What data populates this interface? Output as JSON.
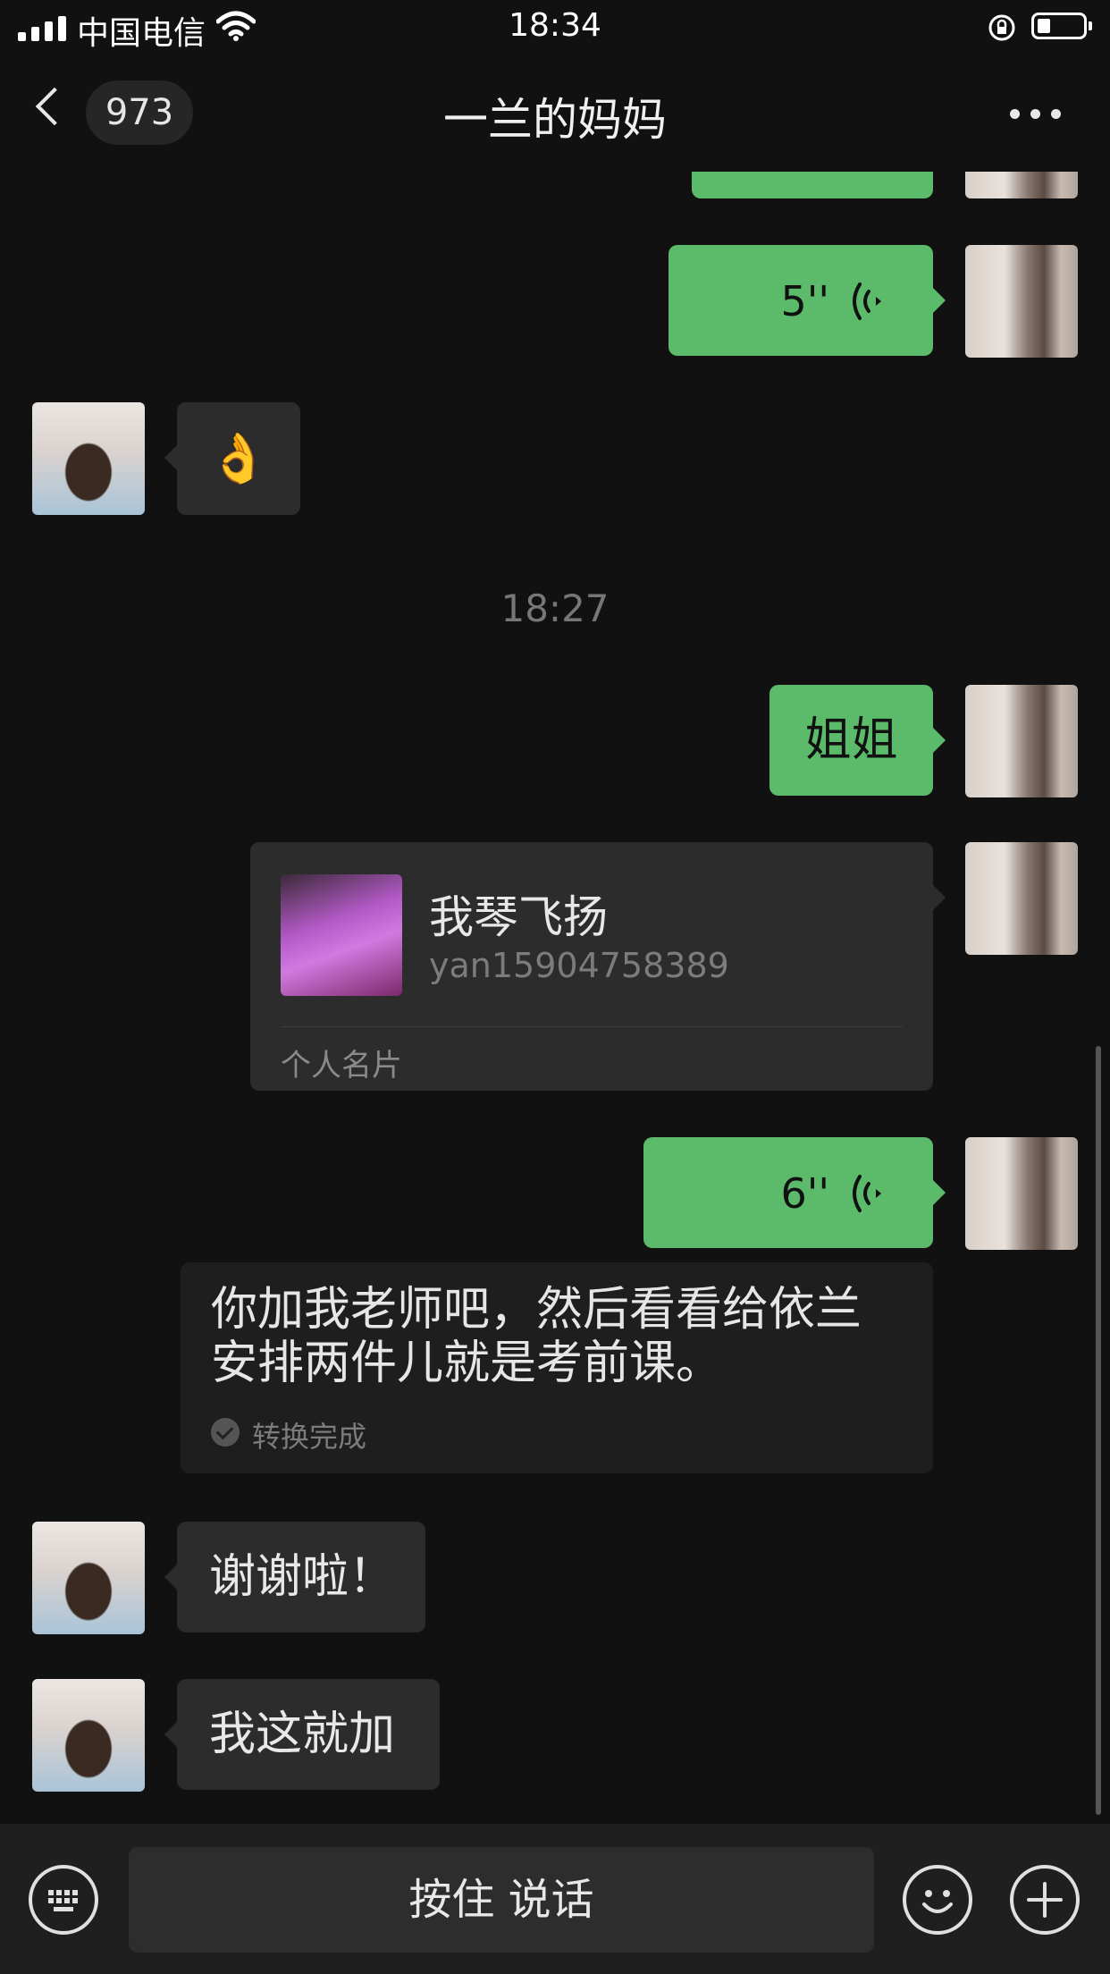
{
  "status_bar": {
    "carrier": "中国电信",
    "time": "18:34"
  },
  "nav": {
    "unread_count": "973",
    "title": "一兰的妈妈"
  },
  "messages": {
    "voice1_duration": "5''",
    "ok_emoji": "👌",
    "timestamp": "18:27",
    "sister_text": "姐姐",
    "card": {
      "name": "我琴飞扬",
      "id": "yan15904758389",
      "label": "个人名片"
    },
    "voice2_duration": "6''",
    "transcription": {
      "line1": "你加我老师吧，然后看看给依兰",
      "line2": "安排两件儿就是考前课。",
      "status": "转换完成"
    },
    "thanks_text": "谢谢啦！",
    "adding_text": "我这就加"
  },
  "bottom_bar": {
    "hold_to_talk": "按住 说话"
  }
}
